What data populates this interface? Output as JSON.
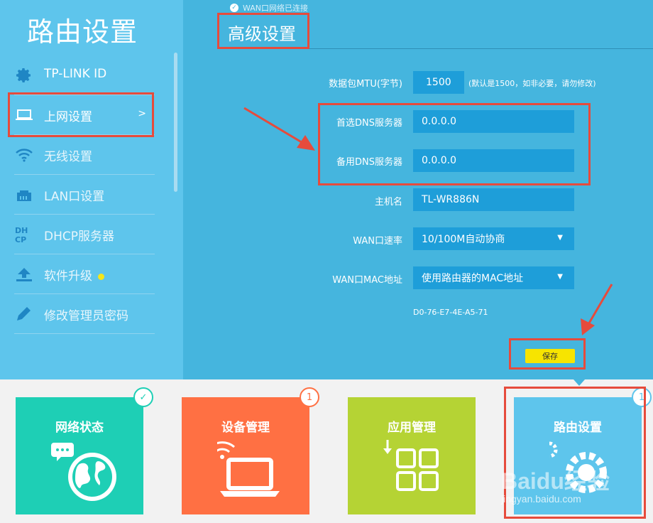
{
  "sidebar": {
    "title": "路由设置",
    "items": [
      {
        "label": "TP-LINK ID",
        "icon": "gear-icon"
      },
      {
        "label": "上网设置",
        "icon": "laptop-icon",
        "chevron": ">"
      },
      {
        "label": "无线设置",
        "icon": "wifi-icon"
      },
      {
        "label": "LAN口设置",
        "icon": "lan-port-icon"
      },
      {
        "label": "DHCP服务器",
        "icon": "dhcp-icon"
      },
      {
        "label": "软件升级",
        "icon": "upload-icon"
      },
      {
        "label": "修改管理员密码",
        "icon": "pencil-icon"
      }
    ]
  },
  "main": {
    "wan_status": "WAN口网络已连接",
    "section_title": "高级设置",
    "mtu": {
      "label": "数据包MTU(字节)",
      "value": "1500",
      "hint": "(默认是1500，如非必要，请勿修改)"
    },
    "dns1": {
      "label": "首选DNS服务器",
      "value": "0.0.0.0"
    },
    "dns2": {
      "label": "备用DNS服务器",
      "value": "0.0.0.0"
    },
    "hostname": {
      "label": "主机名",
      "value": "TL-WR886N"
    },
    "wan_speed": {
      "label": "WAN口速率",
      "value": "10/100M自动协商"
    },
    "wan_mac": {
      "label": "WAN口MAC地址",
      "value": "使用路由器的MAC地址"
    },
    "mac_value": "D0-76-E7-4E-A5-71",
    "save_label": "保存"
  },
  "tiles": [
    {
      "name": "网络状态",
      "color": "#1ecfb5",
      "badge": "✓",
      "badge_color": "#1ecfb5",
      "icon": "globe-icon"
    },
    {
      "name": "设备管理",
      "color": "#ff7043",
      "badge": "1",
      "badge_color": "#ff7043",
      "icon": "devices-icon"
    },
    {
      "name": "应用管理",
      "color": "#b5d334",
      "badge": "",
      "badge_color": "",
      "icon": "apps-icon"
    },
    {
      "name": "路由设置",
      "color": "#5ec5ec",
      "badge": "1",
      "badge_color": "#5ec5ec",
      "icon": "gears-icon"
    }
  ],
  "watermark": {
    "brand": "Baidu经验",
    "url": "jingyan.baidu.com"
  },
  "colors": {
    "sidebar": "#5ec5ec",
    "panel": "#45b5de",
    "highlight": "#e64b3c",
    "save": "#f7e400"
  }
}
